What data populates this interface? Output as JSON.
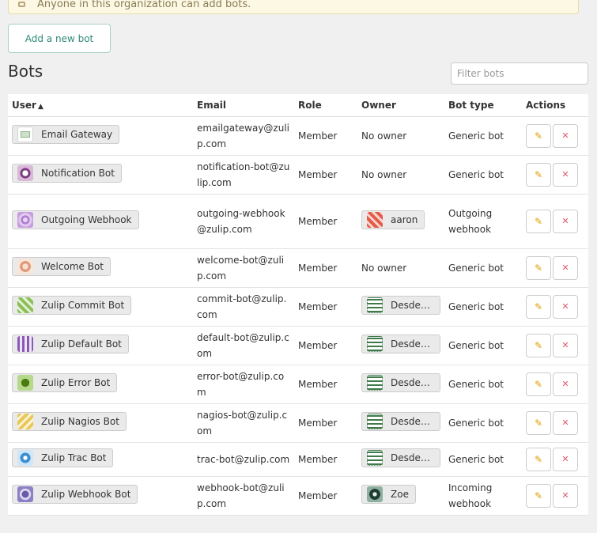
{
  "notice": {
    "text": "Anyone in this organization can add bots."
  },
  "add_button": "Add a new bot",
  "title": "Bots",
  "filter": {
    "placeholder": "Filter bots",
    "value": ""
  },
  "columns": {
    "user": "User",
    "email": "Email",
    "role": "Role",
    "owner": "Owner",
    "bot_type": "Bot type",
    "actions": "Actions"
  },
  "sort_indicator": "▲",
  "icons": {
    "edit": "✎",
    "deactivate": "✕",
    "notice": "warning-icon"
  },
  "rows": [
    {
      "name": "Email Gateway",
      "email": "emailgateway@zulip.com",
      "role": "Member",
      "owner": "No owner",
      "type": "Generic bot"
    },
    {
      "name": "Notification Bot",
      "email": "notification-bot@zulip.com",
      "role": "Member",
      "owner": "No owner",
      "type": "Generic bot"
    },
    {
      "name": "Outgoing Webhook",
      "email": "outgoing-webhook@zulip.com",
      "role": "Member",
      "owner": "aaron",
      "type": "Outgoing webhook"
    },
    {
      "name": "Welcome Bot",
      "email": "welcome-bot@zulip.com",
      "role": "Member",
      "owner": "No owner",
      "type": "Generic bot"
    },
    {
      "name": "Zulip Commit Bot",
      "email": "commit-bot@zulip.com",
      "role": "Member",
      "owner": "Desdem…",
      "type": "Generic bot"
    },
    {
      "name": "Zulip Default Bot",
      "email": "default-bot@zulip.com",
      "role": "Member",
      "owner": "Desdem…",
      "type": "Generic bot"
    },
    {
      "name": "Zulip Error Bot",
      "email": "error-bot@zulip.com",
      "role": "Member",
      "owner": "Desdem…",
      "type": "Generic bot"
    },
    {
      "name": "Zulip Nagios Bot",
      "email": "nagios-bot@zulip.com",
      "role": "Member",
      "owner": "Desdem…",
      "type": "Generic bot"
    },
    {
      "name": "Zulip Trac Bot",
      "email": "trac-bot@zulip.com",
      "role": "Member",
      "owner": "Desdem…",
      "type": "Generic bot"
    },
    {
      "name": "Zulip Webhook Bot",
      "email": "webhook-bot@zulip.com",
      "role": "Member",
      "owner": "Zoe",
      "type": "Incoming webhook"
    }
  ]
}
